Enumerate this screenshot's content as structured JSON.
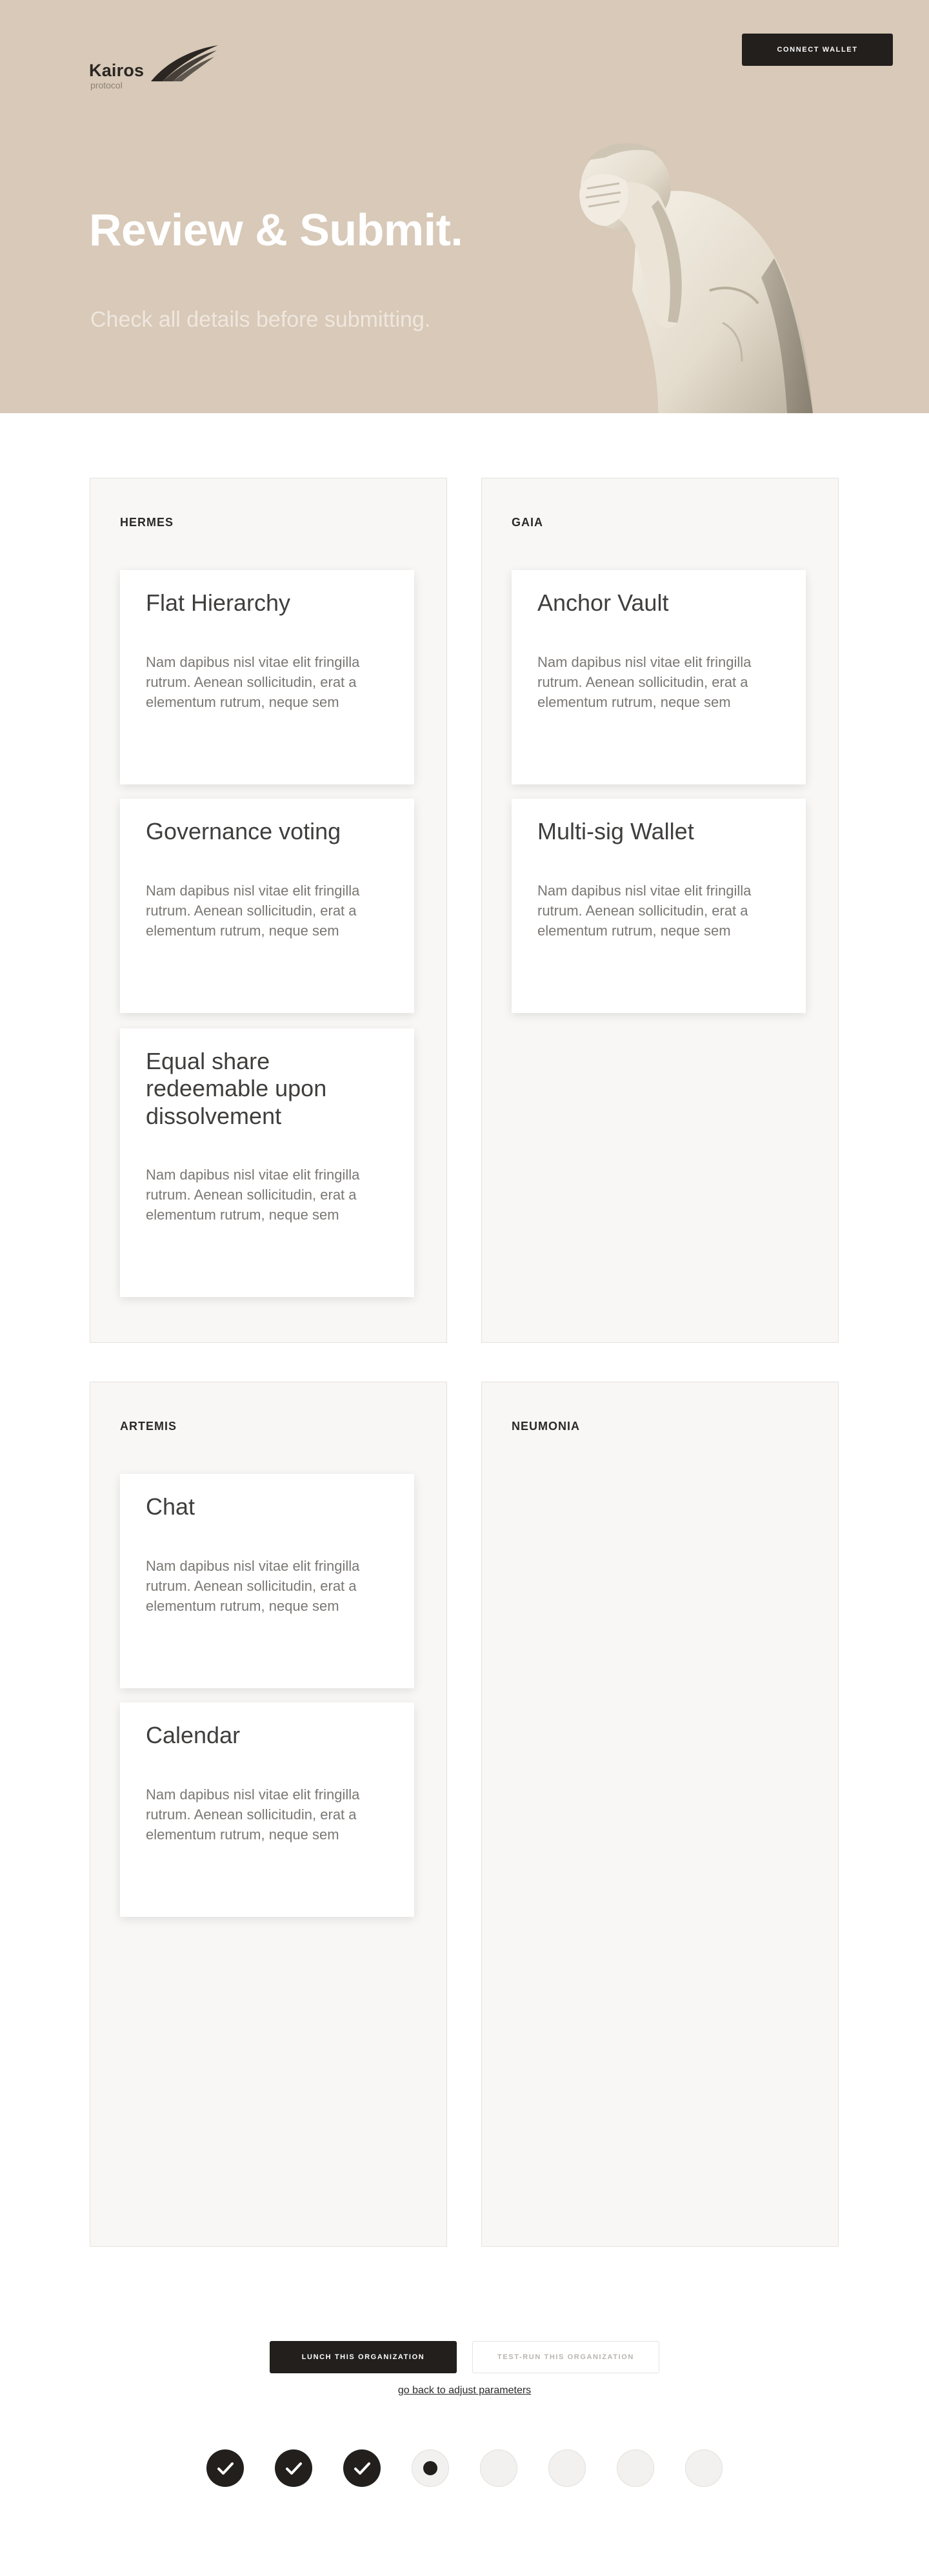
{
  "header": {
    "logo_word": "Kairos",
    "logo_sub": "protocol",
    "connect_wallet_label": "CONNECT WALLET"
  },
  "hero": {
    "title": "Review & Submit.",
    "subtitle": "Check all details before submitting."
  },
  "panels": [
    {
      "title": "HERMES",
      "items": [
        {
          "title": "Flat Hierarchy",
          "desc": "Nam dapibus nisl vitae elit fringilla rutrum. Aenean sollicitudin, erat a elementum rutrum, neque sem"
        },
        {
          "title": "Governance voting",
          "desc": "Nam dapibus nisl vitae elit fringilla rutrum. Aenean sollicitudin, erat a elementum rutrum, neque sem"
        },
        {
          "title": "Equal share redeemable upon dissolvement",
          "desc": "Nam dapibus nisl vitae elit fringilla rutrum. Aenean sollicitudin, erat a elementum rutrum, neque sem"
        }
      ]
    },
    {
      "title": "GAIA",
      "items": [
        {
          "title": "Anchor Vault",
          "desc": "Nam dapibus nisl vitae elit fringilla rutrum. Aenean sollicitudin, erat a elementum rutrum, neque sem"
        },
        {
          "title": "Multi-sig Wallet",
          "desc": "Nam dapibus nisl vitae elit fringilla rutrum. Aenean sollicitudin, erat a elementum rutrum, neque sem"
        }
      ]
    },
    {
      "title": "ARTEMIS",
      "items": [
        {
          "title": "Chat",
          "desc": "Nam dapibus nisl vitae elit fringilla rutrum. Aenean sollicitudin, erat a elementum rutrum, neque sem"
        },
        {
          "title": "Calendar",
          "desc": "Nam dapibus nisl vitae elit fringilla rutrum. Aenean sollicitudin, erat a elementum rutrum, neque sem"
        }
      ]
    },
    {
      "title": "NEUMONIA",
      "items": []
    }
  ],
  "actions": {
    "launch_label": "LUNCH THIS ORGANIZATION",
    "test_label": "TEST-RUN THIS ORGANIZATION",
    "back_link": "go back to adjust parameters"
  },
  "steps": [
    "done",
    "done",
    "done",
    "current",
    "todo",
    "todo",
    "todo",
    "todo"
  ],
  "colors": {
    "hero_bg": "#d8c9b8",
    "dark": "#221f1d",
    "panel_bg": "#f8f7f6"
  }
}
